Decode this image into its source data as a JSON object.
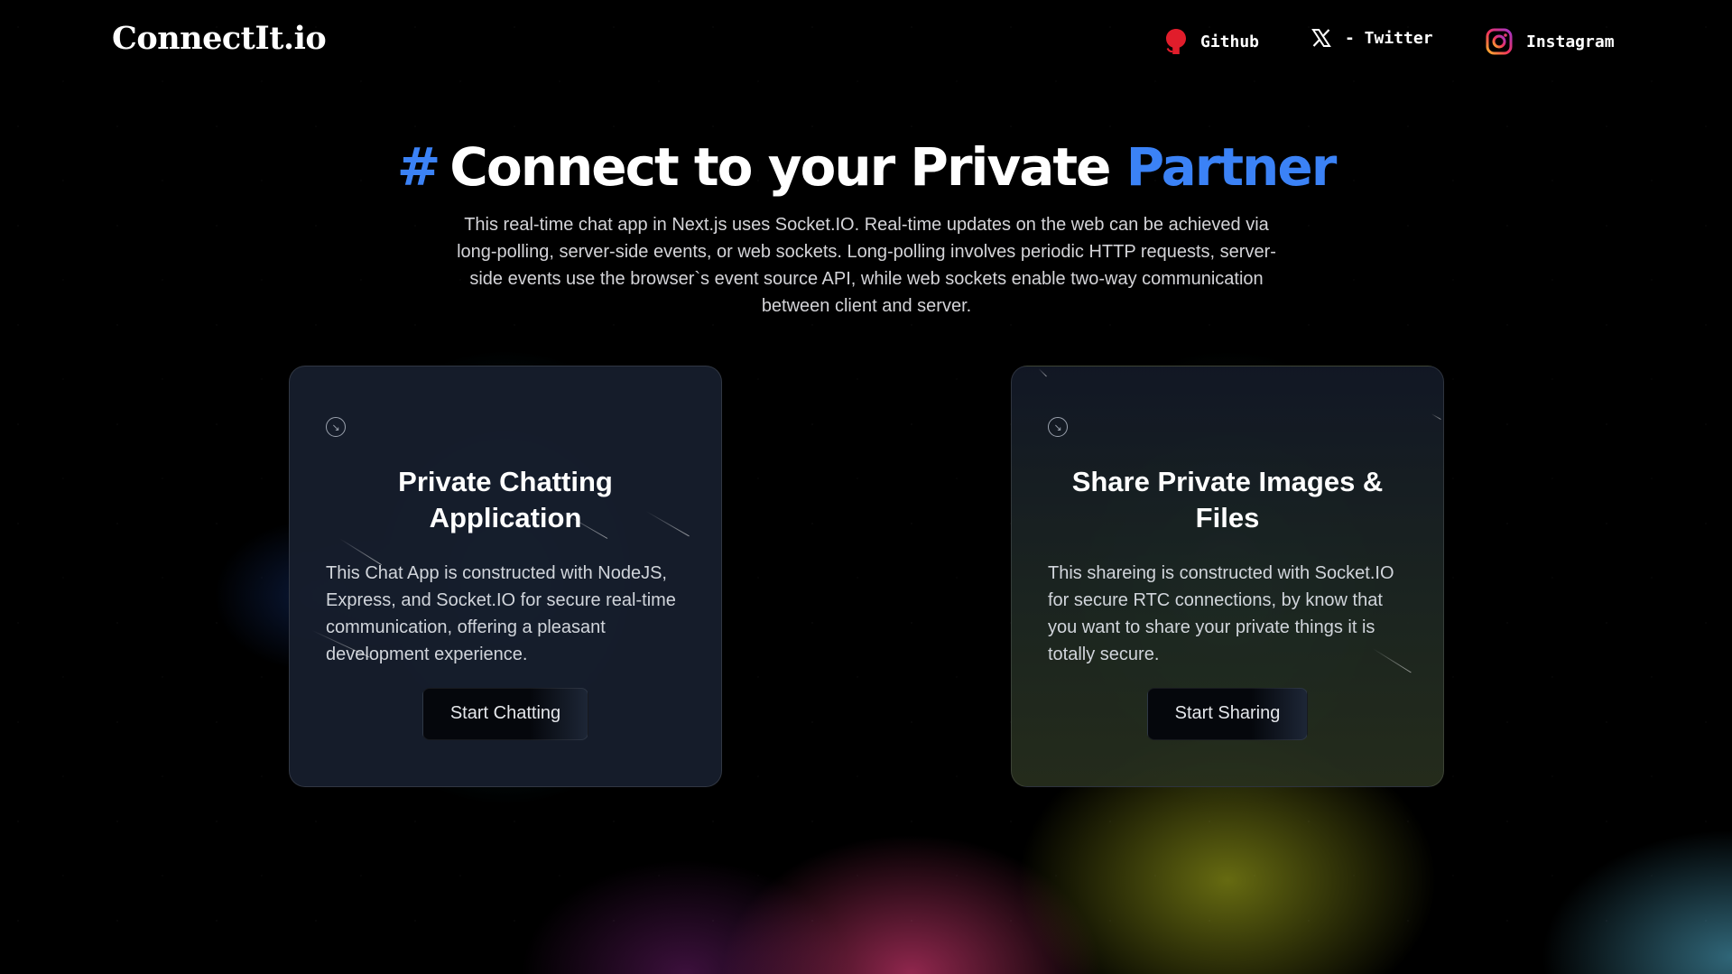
{
  "brand": {
    "logo": "ConnectIt.io"
  },
  "nav": {
    "links": [
      {
        "label": "Github",
        "icon": "github-icon"
      },
      {
        "label": "- Twitter",
        "icon": "x-icon"
      },
      {
        "label": "Instagram",
        "icon": "instagram-icon"
      }
    ]
  },
  "hero": {
    "hash": "#",
    "title": "Connect to your Private",
    "title_accent": "Partner",
    "description": "This real-time chat app in Next.js uses Socket.IO. Real-time updates on the web can be achieved via long-polling, server-side events, or web sockets. Long-polling involves periodic HTTP requests, server-side events use the browser`s event source API, while web sockets enable two-way communication between client and server."
  },
  "cards": [
    {
      "icon": "arrow-down-right-icon",
      "title": "Private Chatting Application",
      "text": "This Chat App is constructed with NodeJS, Express, and Socket.IO for secure real-time communication, offering a pleasant development experience.",
      "button": "Start Chatting"
    },
    {
      "icon": "arrow-down-right-icon",
      "title": "Share Private Images & Files",
      "text": "This shareing is constructed with Socket.IO for secure RTC connections, by know that you want to share your private things it is totally secure.",
      "button": "Start Sharing"
    }
  ],
  "colors": {
    "accent": "#3b82f6",
    "background": "#000000",
    "card": "#161d2c",
    "github_icon": "#e11d2b"
  }
}
